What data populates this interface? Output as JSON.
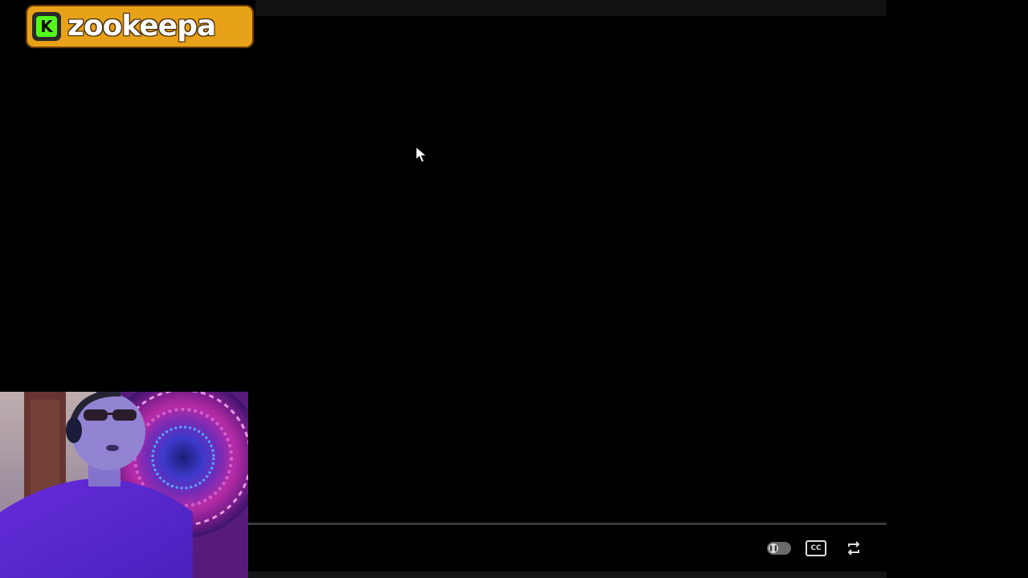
{
  "logo": {
    "badge_letter": "K",
    "text": "zookeepa",
    "badge_color": "#53fc18",
    "frame_color": "#e8a21a"
  },
  "player": {
    "controls": {
      "autoplay_toggle_icon": "pause-icon",
      "captions_label": "CC",
      "loop_icon": "loop-icon"
    }
  },
  "webcam": {
    "icon": "webcam-feed"
  }
}
